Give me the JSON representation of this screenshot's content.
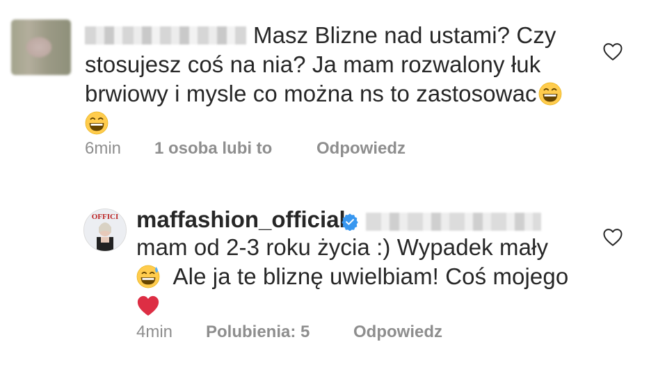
{
  "comment1": {
    "text_line1": "Masz Blizne nad ustami? Czy",
    "text_line2": "stosujesz coś na nia? Ja mam rozwalony łuk",
    "text_line3": "brwiowy i mysle co można ns to zastosowac",
    "time": "6min",
    "likes": "1 osoba lubi to",
    "reply_label": "Odpowiedz"
  },
  "comment2": {
    "username": "maffashion_official",
    "text_line1": "mam od 2-3 roku życia :) Wypadek mały",
    "text_line2": "Ale ja te bliznę uwielbiam! Coś mojego",
    "time": "4min",
    "likes": "Polubienia: 5",
    "reply_label": "Odpowiedz"
  },
  "icons": {
    "like": "heart-outline-icon",
    "verified": "verified-badge-icon",
    "emoji_grin": "grinning-face-emoji",
    "emoji_sweat": "grinning-sweat-emoji",
    "emoji_heart": "red-heart-emoji"
  },
  "colors": {
    "text": "#262626",
    "meta": "#8e8e8e",
    "verified": "#3897f0",
    "heart": "#e0245e"
  }
}
